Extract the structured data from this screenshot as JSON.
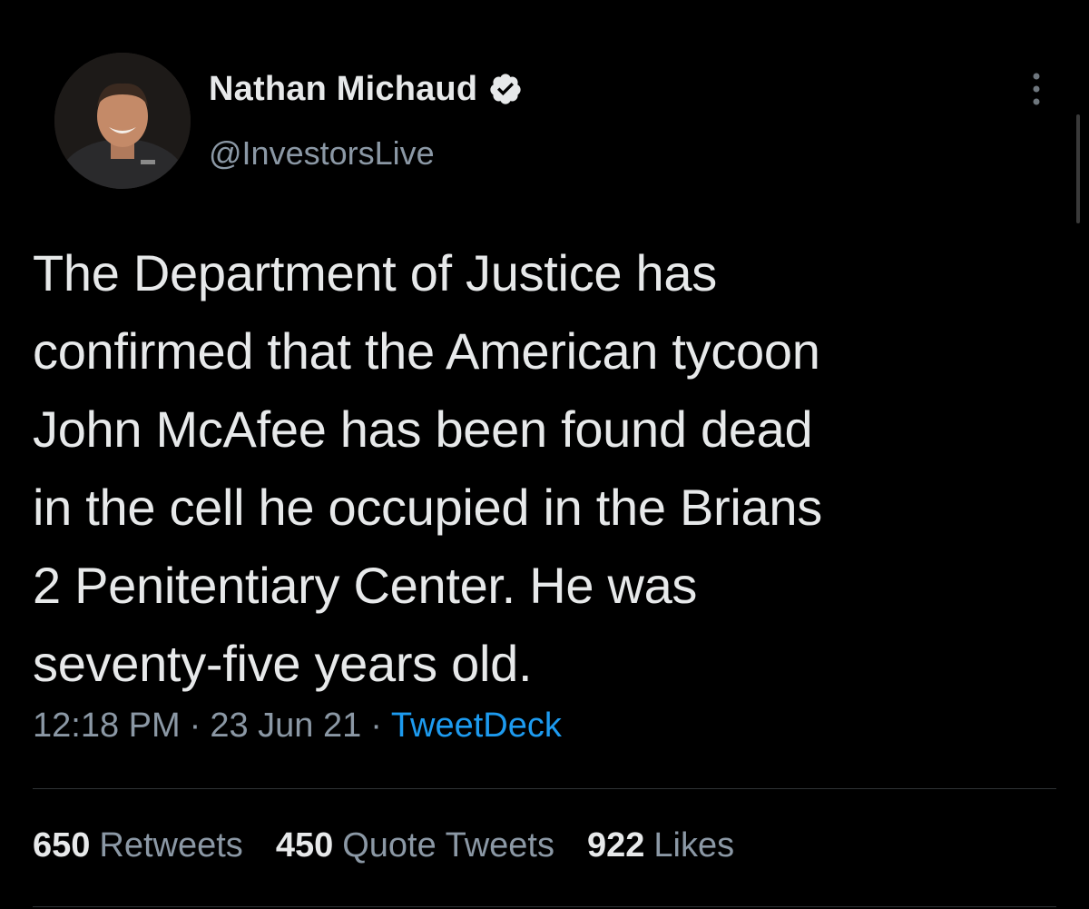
{
  "author": {
    "display_name": "Nathan Michaud",
    "handle": "@InvestorsLive",
    "avatar_icon": "profile-photo",
    "verified_icon": "verified-badge-icon"
  },
  "tweet": {
    "text": "The Department of Justice has\nconfirmed that the American tycoon\nJohn McAfee has been found dead\nin the cell he occupied in the Brians\n2 Penitentiary Center. He was\nseventy-five years old."
  },
  "meta": {
    "time": "12:18 PM",
    "separator": "·",
    "date": "23 Jun 21",
    "source": "TweetDeck"
  },
  "stats": {
    "retweets_count": "650",
    "retweets_label": "Retweets",
    "quotes_count": "450",
    "quotes_label": "Quote Tweets",
    "likes_count": "922",
    "likes_label": "Likes"
  },
  "colors": {
    "background": "#000000",
    "text": "#e7e9ea",
    "muted": "#8b98a5",
    "accent": "#1d9bf0",
    "divider": "#2f3336"
  }
}
